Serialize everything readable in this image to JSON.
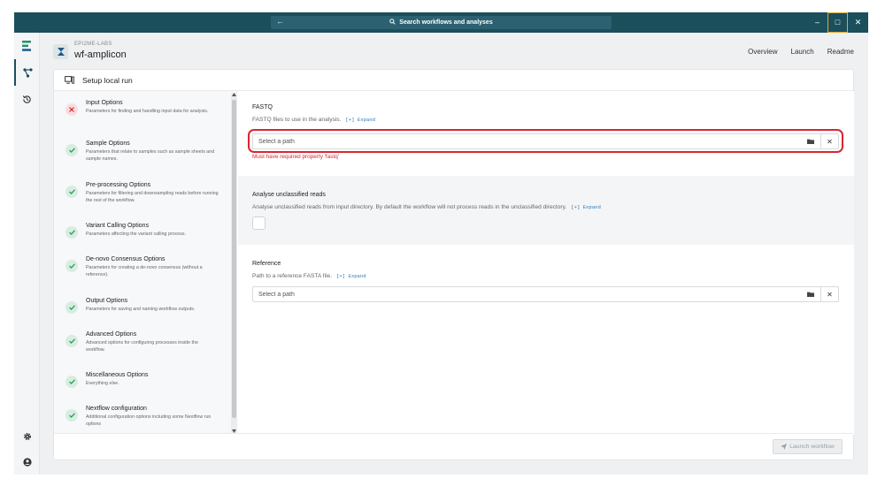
{
  "titlebar": {
    "search_label": "Search workflows and analyses",
    "back_arrow": "←",
    "minimize": "–",
    "maximize": "□",
    "close": "✕"
  },
  "workflow": {
    "org": "EPI2ME-LABS",
    "name": "wf-amplicon"
  },
  "top_nav": [
    "Overview",
    "Launch",
    "Readme"
  ],
  "panel": {
    "title": "Setup local run"
  },
  "steps": [
    {
      "title": "Input Options",
      "description": "Parameters for finding and handling input data for analysis.",
      "status": "error"
    },
    {
      "title": "Sample Options",
      "description": "Parameters that relate to samples such as sample sheets and sample names.",
      "status": "ok"
    },
    {
      "title": "Pre-processing Options",
      "description": "Parameters for filtering and downsampling reads before running the rest of the workflow.",
      "status": "ok"
    },
    {
      "title": "Variant Calling Options",
      "description": "Parameters affecting the variant calling process.",
      "status": "ok"
    },
    {
      "title": "De-novo Consensus Options",
      "description": "Parameters for creating a de-novo consensus (without a reference).",
      "status": "ok"
    },
    {
      "title": "Output Options",
      "description": "Parameters for saving and naming workflow outputs.",
      "status": "ok"
    },
    {
      "title": "Advanced Options",
      "description": "Advanced options for configuring processes inside the workflow.",
      "status": "ok"
    },
    {
      "title": "Miscellaneous Options",
      "description": "Everything else.",
      "status": "ok"
    },
    {
      "title": "Nextflow configuration",
      "description": "Additional configuration options including some Nextflow run options",
      "status": "ok"
    }
  ],
  "fields": {
    "fastq": {
      "label": "FASTQ",
      "description": "FASTQ files to use in the analysis.",
      "expand": "[+] Expand",
      "placeholder": "Select a path",
      "error": "Must have required property 'fastq'"
    },
    "unclassified": {
      "label": "Analyse unclassified reads",
      "description": "Analyse unclassified reads from input directory. By default the workflow will not process reads in the unclassified directory.",
      "expand": "[+] Expand"
    },
    "reference": {
      "label": "Reference",
      "description": "Path to a reference FASTA file.",
      "expand": "[+] Expand",
      "placeholder": "Select a path"
    }
  },
  "footer": {
    "launch_label": "Launch workflow"
  },
  "colors": {
    "titlebar": "#1b4f5c",
    "error": "#d9262f",
    "ok": "#2f9a5b",
    "link": "#2a7ab8"
  }
}
